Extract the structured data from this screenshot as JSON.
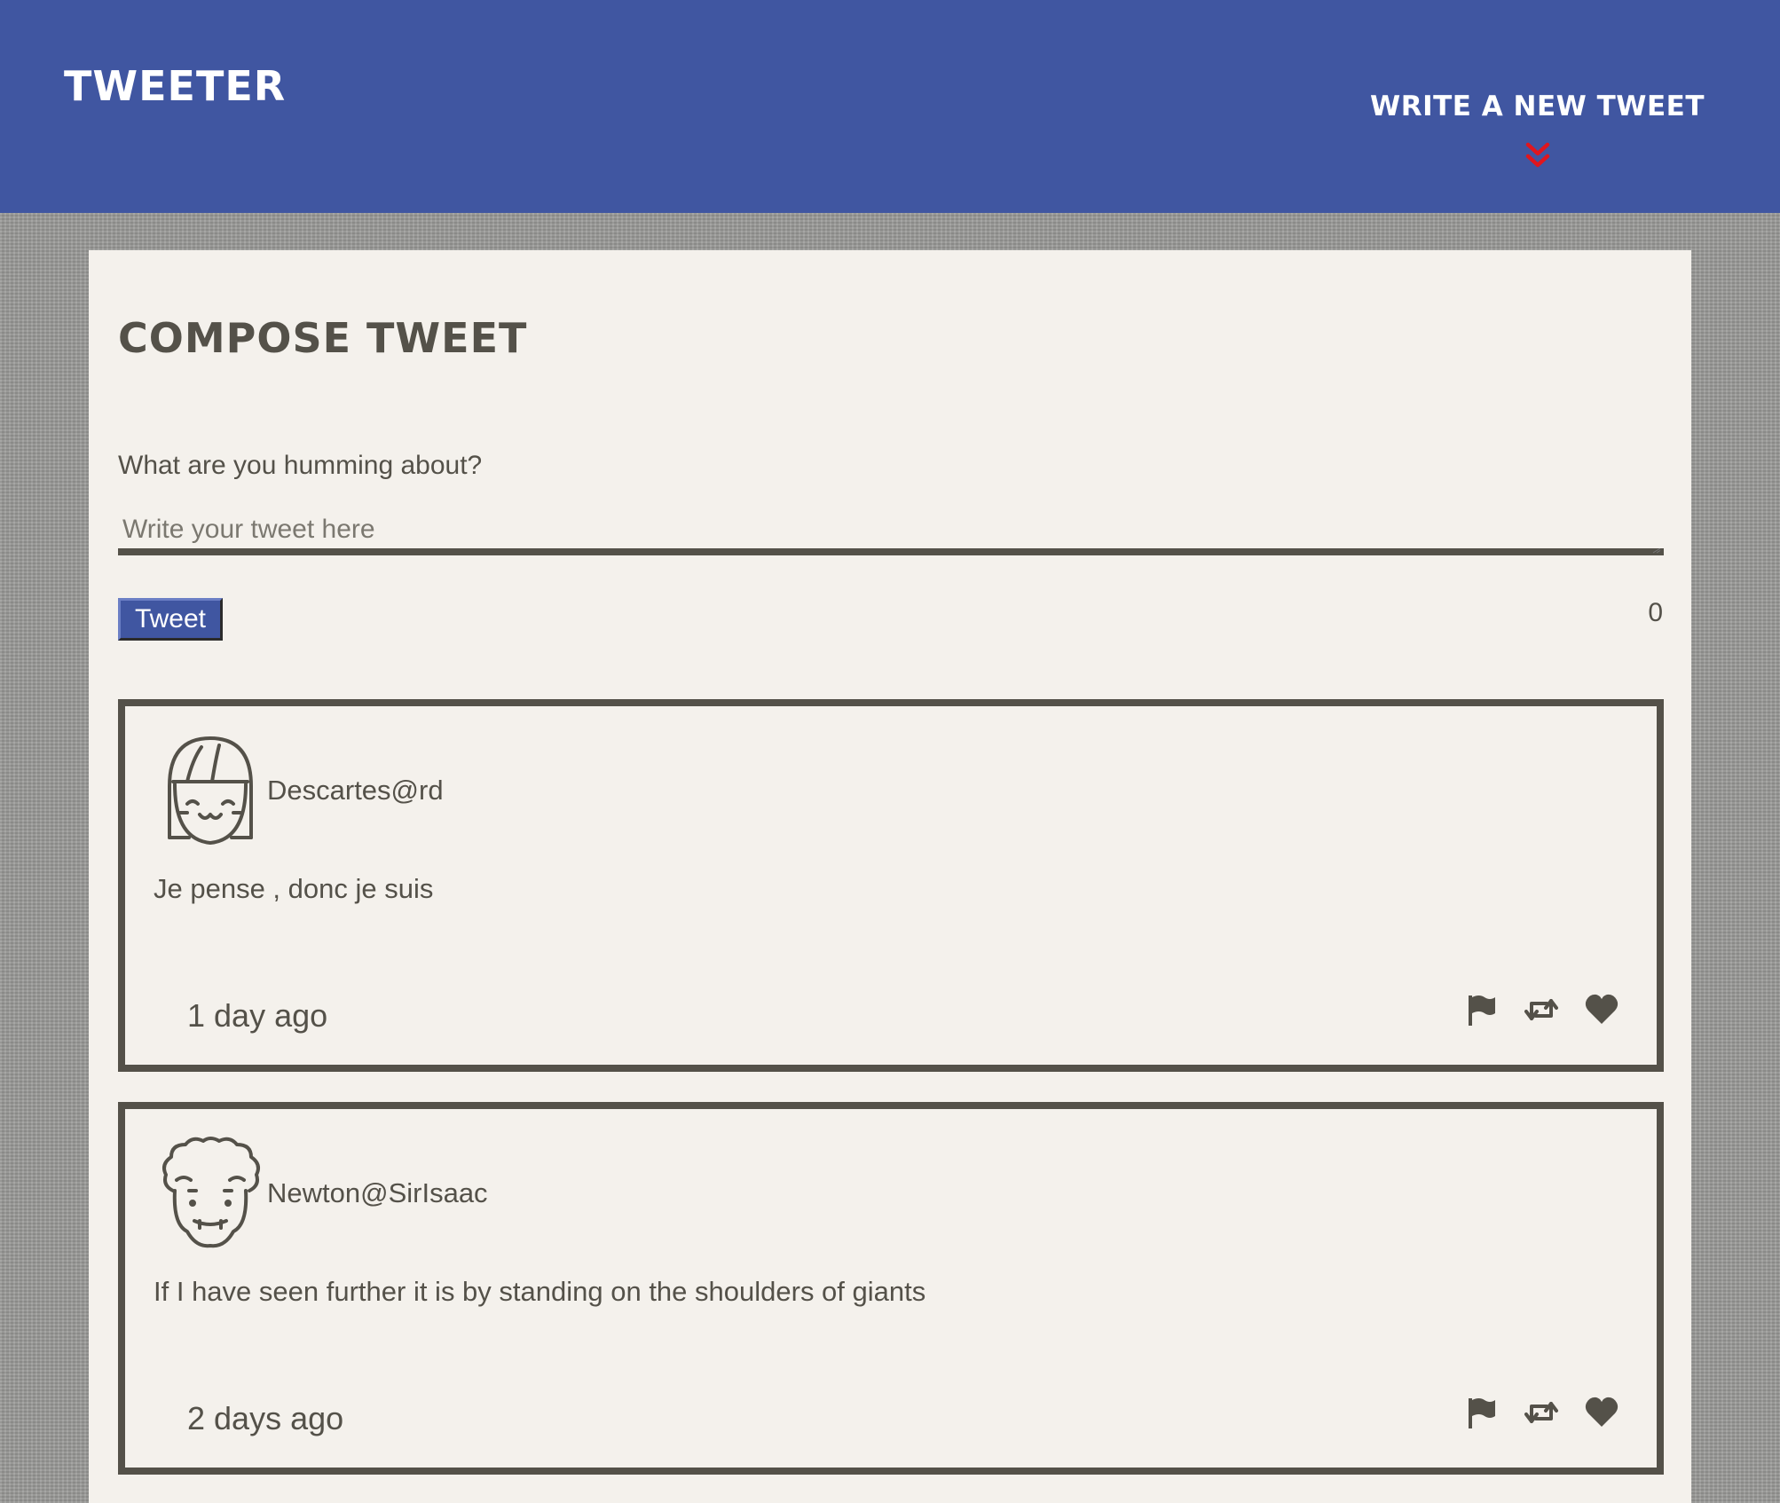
{
  "nav": {
    "brand": "TWEETER",
    "cta_label": "WRITE A NEW TWEET",
    "cta_icon": "double-chevron-down-icon",
    "accent_color": "#4056a1",
    "chevron_color": "#e0161e"
  },
  "compose": {
    "title": "COMPOSE TWEET",
    "label": "What are you humming about?",
    "placeholder": "Write your tweet here",
    "button_label": "Tweet",
    "counter": "0"
  },
  "tweets": [
    {
      "avatar": "avatar-girl-icon",
      "handle": "Descartes@rd",
      "content": "Je pense , donc je suis",
      "timestamp": "1 day ago",
      "actions": [
        "flag-icon",
        "retweet-icon",
        "heart-icon"
      ]
    },
    {
      "avatar": "avatar-curly-hair-icon",
      "handle": "Newton@SirIsaac",
      "content": "If I have seen further it is by standing on the shoulders of giants",
      "timestamp": "2 days ago",
      "actions": [
        "flag-icon",
        "retweet-icon",
        "heart-icon"
      ]
    }
  ]
}
